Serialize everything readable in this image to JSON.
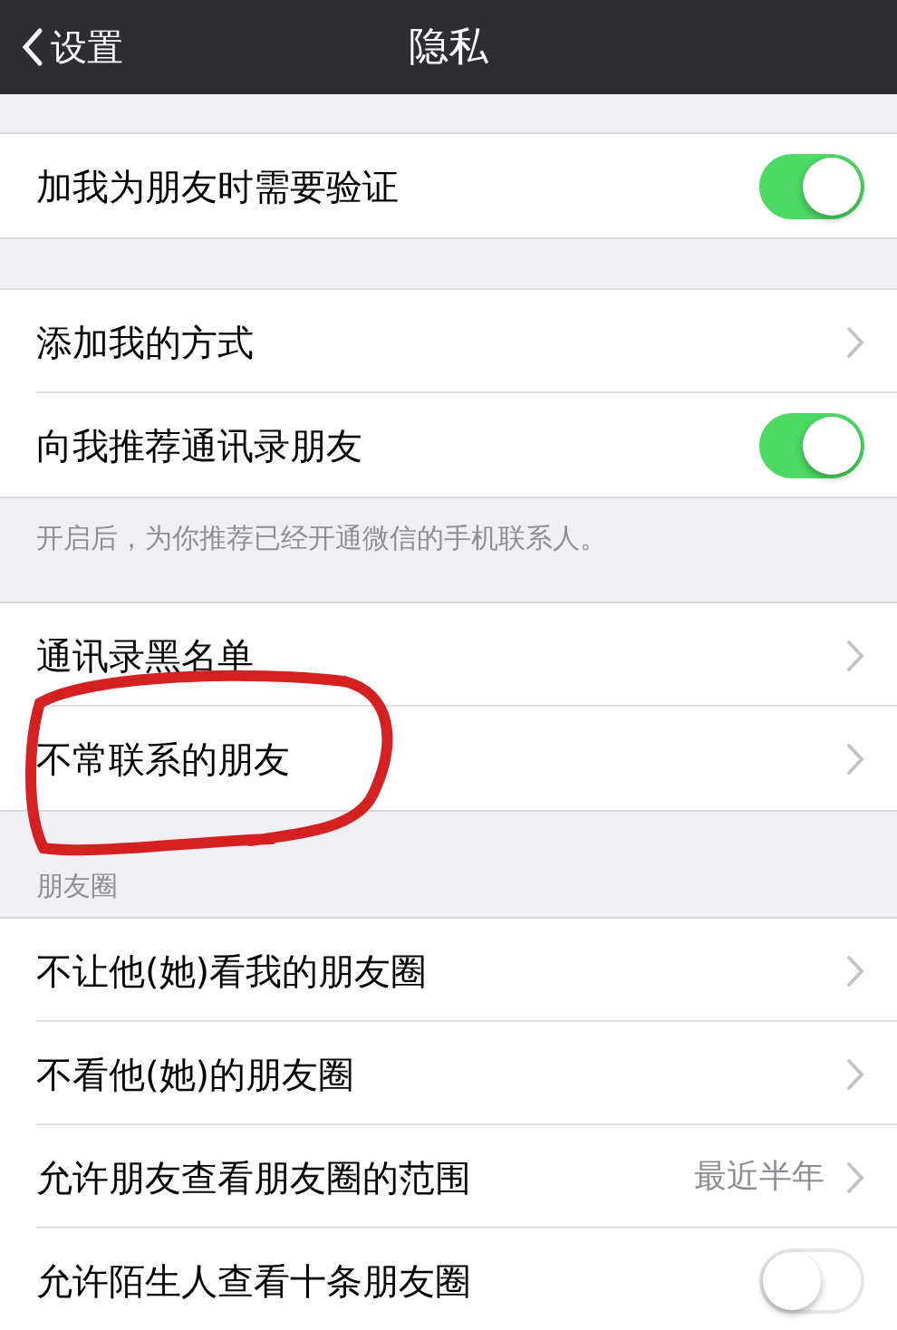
{
  "nav_bar": {
    "back_label": "设置",
    "title": "隐私"
  },
  "sections": [
    {
      "rows": [
        {
          "kind": "switch",
          "label": "加我为朋友时需要验证",
          "on": true
        }
      ]
    },
    {
      "rows": [
        {
          "kind": "link",
          "label": "添加我的方式"
        },
        {
          "kind": "switch",
          "label": "向我推荐通讯录朋友",
          "on": true
        }
      ],
      "footer": "开启后，为你推荐已经开通微信的手机联系人。"
    },
    {
      "rows": [
        {
          "kind": "link",
          "label": "通讯录黑名单"
        },
        {
          "kind": "link",
          "label": "不常联系的朋友"
        }
      ]
    },
    {
      "header": "朋友圈",
      "rows": [
        {
          "kind": "link",
          "label": "不让他(她)看我的朋友圈"
        },
        {
          "kind": "link",
          "label": "不看他(她)的朋友圈"
        },
        {
          "kind": "link",
          "label": "允许朋友查看朋友圈的范围",
          "value": "最近半年"
        },
        {
          "kind": "switch",
          "label": "允许陌生人查看十条朋友圈",
          "on": false
        }
      ]
    }
  ]
}
